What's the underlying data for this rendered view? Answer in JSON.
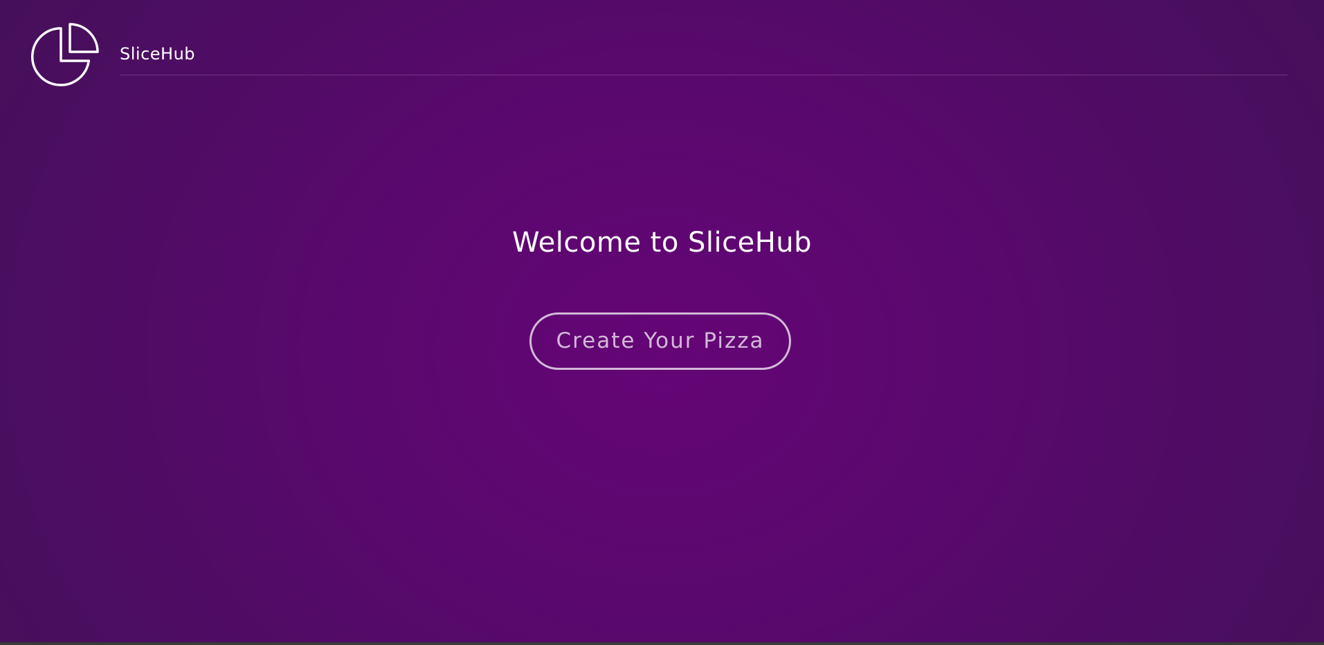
{
  "header": {
    "logo_icon": "pie-chart-icon",
    "brand_name": "SliceHub"
  },
  "main": {
    "title": "Welcome to SliceHub",
    "cta_label": "Create Your Pizza"
  },
  "colors": {
    "background_center": "#650576",
    "background_edge": "#3d1152",
    "text": "#ffffff"
  }
}
